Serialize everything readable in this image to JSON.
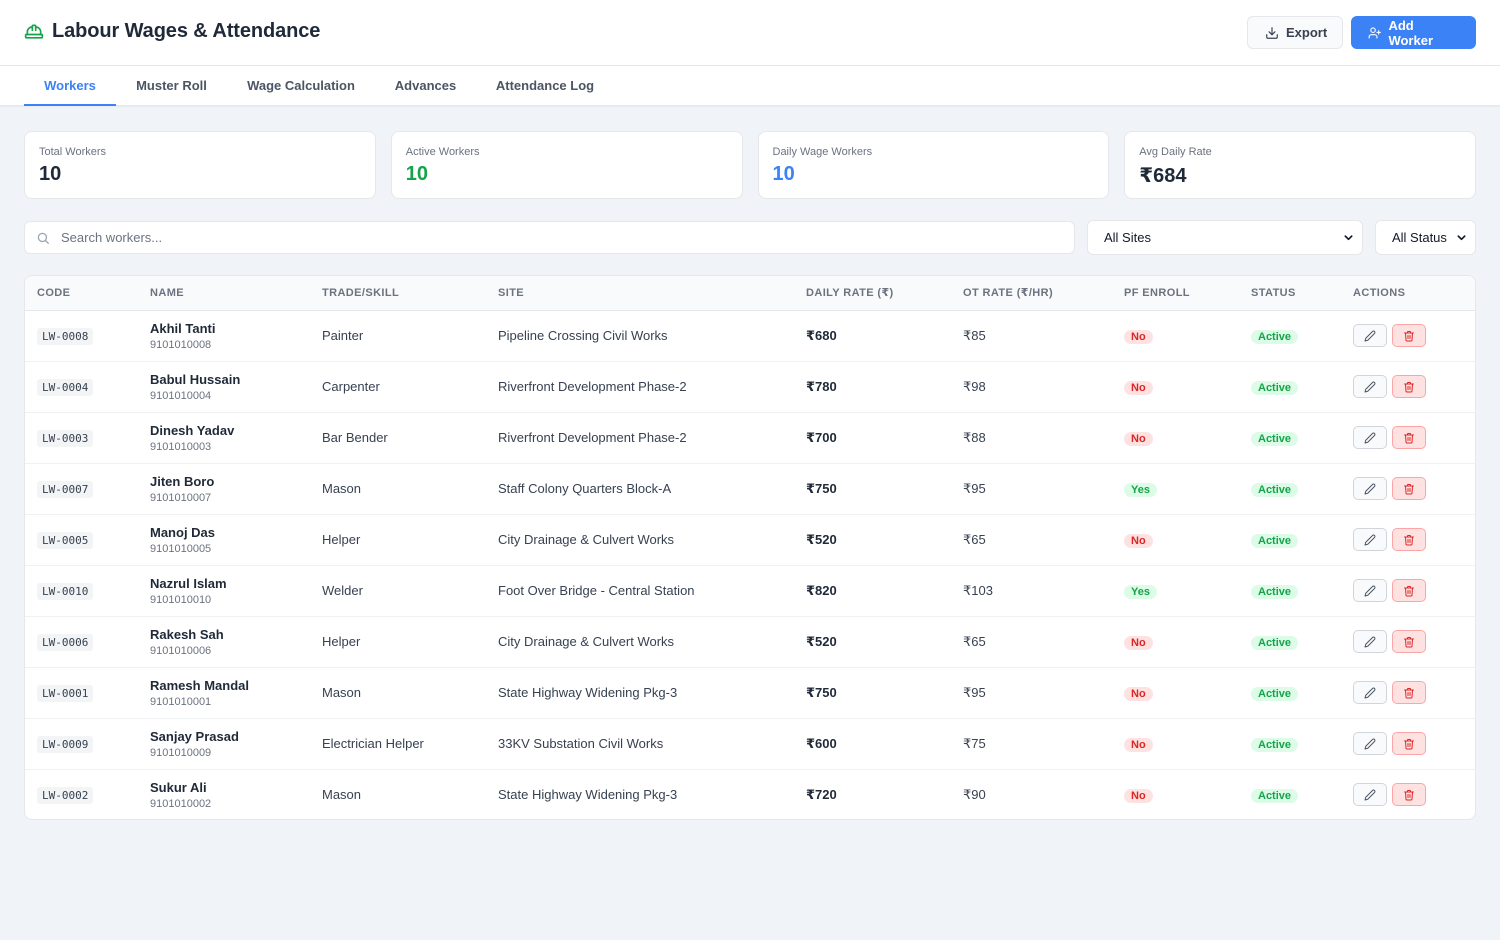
{
  "app": {
    "title": "Labour Wages & Attendance"
  },
  "header": {
    "export_label": "Export",
    "add_label": "Add Worker"
  },
  "tabs": [
    {
      "label": "Workers",
      "active": true
    },
    {
      "label": "Muster Roll",
      "active": false
    },
    {
      "label": "Wage Calculation",
      "active": false
    },
    {
      "label": "Advances",
      "active": false
    },
    {
      "label": "Attendance Log",
      "active": false
    }
  ],
  "stats": [
    {
      "label": "Total Workers",
      "value": "10",
      "color": "#1f2937"
    },
    {
      "label": "Active Workers",
      "value": "10",
      "color": "#16a34a"
    },
    {
      "label": "Daily Wage Workers",
      "value": "10",
      "color": "#3b82f6"
    },
    {
      "label": "Avg Daily Rate",
      "value": "₹684",
      "color": "#1f2937"
    }
  ],
  "filters": {
    "search_placeholder": "Search workers...",
    "site_selected": "All Sites",
    "status_selected": "All Status"
  },
  "table": {
    "columns": [
      "CODE",
      "NAME",
      "TRADE/SKILL",
      "SITE",
      "DAILY RATE (₹)",
      "OT RATE (₹/HR)",
      "PF ENROLL",
      "STATUS",
      "ACTIONS"
    ],
    "rows": [
      {
        "code": "LW-0008",
        "name": "Akhil Tanti",
        "phone": "9101010008",
        "trade": "Painter",
        "site": "Pipeline Crossing Civil Works",
        "daily": "₹680",
        "ot": "₹85",
        "pf": "No",
        "status": "Active"
      },
      {
        "code": "LW-0004",
        "name": "Babul Hussain",
        "phone": "9101010004",
        "trade": "Carpenter",
        "site": "Riverfront Development Phase-2",
        "daily": "₹780",
        "ot": "₹98",
        "pf": "No",
        "status": "Active"
      },
      {
        "code": "LW-0003",
        "name": "Dinesh Yadav",
        "phone": "9101010003",
        "trade": "Bar Bender",
        "site": "Riverfront Development Phase-2",
        "daily": "₹700",
        "ot": "₹88",
        "pf": "No",
        "status": "Active"
      },
      {
        "code": "LW-0007",
        "name": "Jiten Boro",
        "phone": "9101010007",
        "trade": "Mason",
        "site": "Staff Colony Quarters Block-A",
        "daily": "₹750",
        "ot": "₹95",
        "pf": "Yes",
        "status": "Active"
      },
      {
        "code": "LW-0005",
        "name": "Manoj Das",
        "phone": "9101010005",
        "trade": "Helper",
        "site": "City Drainage & Culvert Works",
        "daily": "₹520",
        "ot": "₹65",
        "pf": "No",
        "status": "Active"
      },
      {
        "code": "LW-0010",
        "name": "Nazrul Islam",
        "phone": "9101010010",
        "trade": "Welder",
        "site": "Foot Over Bridge - Central Station",
        "daily": "₹820",
        "ot": "₹103",
        "pf": "Yes",
        "status": "Active"
      },
      {
        "code": "LW-0006",
        "name": "Rakesh Sah",
        "phone": "9101010006",
        "trade": "Helper",
        "site": "City Drainage & Culvert Works",
        "daily": "₹520",
        "ot": "₹65",
        "pf": "No",
        "status": "Active"
      },
      {
        "code": "LW-0001",
        "name": "Ramesh Mandal",
        "phone": "9101010001",
        "trade": "Mason",
        "site": "State Highway Widening Pkg-3",
        "daily": "₹750",
        "ot": "₹95",
        "pf": "No",
        "status": "Active"
      },
      {
        "code": "LW-0009",
        "name": "Sanjay Prasad",
        "phone": "9101010009",
        "trade": "Electrician Helper",
        "site": "33KV Substation Civil Works",
        "daily": "₹600",
        "ot": "₹75",
        "pf": "No",
        "status": "Active"
      },
      {
        "code": "LW-0002",
        "name": "Sukur Ali",
        "phone": "9101010002",
        "trade": "Mason",
        "site": "State Highway Widening Pkg-3",
        "daily": "₹720",
        "ot": "₹90",
        "pf": "No",
        "status": "Active"
      }
    ]
  },
  "icons": {
    "logo": "hard-hat-icon",
    "export": "download-icon",
    "add": "user-plus-icon",
    "search": "search-icon",
    "edit": "pencil-icon",
    "delete": "trash-icon"
  }
}
